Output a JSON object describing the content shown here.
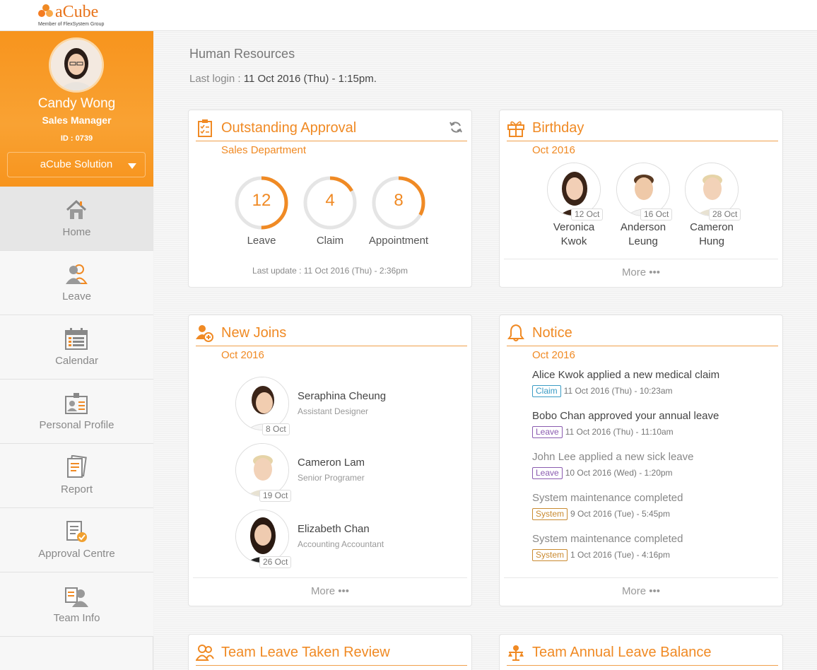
{
  "brand": {
    "logo_text": "aCube",
    "logo_sub": "Member of FlexSystem Group",
    "accent": "#f08a24"
  },
  "profile": {
    "name": "Candy Wong",
    "role": "Sales Manager",
    "id": "ID : 0739",
    "company": "aCube Solution"
  },
  "nav": [
    {
      "label": "Home",
      "icon": "home-icon"
    },
    {
      "label": "Leave",
      "icon": "users-icon"
    },
    {
      "label": "Calendar",
      "icon": "calendar-icon"
    },
    {
      "label": "Personal Profile",
      "icon": "id-badge-icon"
    },
    {
      "label": "Report",
      "icon": "report-icon"
    },
    {
      "label": "Approval Centre",
      "icon": "approval-icon"
    },
    {
      "label": "Team Info",
      "icon": "team-icon"
    }
  ],
  "header": {
    "title": "Human Resources",
    "last_login_label": "Last login :",
    "last_login_value": "11 Oct 2016 (Thu) - 1:15pm."
  },
  "approval": {
    "title": "Outstanding Approval",
    "subtitle": "Sales Department",
    "items": [
      {
        "value": "12",
        "label": "Leave",
        "progress": 0.5
      },
      {
        "value": "4",
        "label": "Claim",
        "progress": 0.17
      },
      {
        "value": "8",
        "label": "Appointment",
        "progress": 0.33
      }
    ],
    "last_update": "Last update : 11 Oct 2016 (Thu) - 2:36pm"
  },
  "birthday": {
    "title": "Birthday",
    "subtitle": "Oct 2016",
    "people": [
      {
        "name1": "Veronica",
        "name2": "Kwok",
        "date": "12 Oct"
      },
      {
        "name1": "Anderson",
        "name2": "Leung",
        "date": "16 Oct"
      },
      {
        "name1": "Cameron",
        "name2": "Hung",
        "date": "28 Oct"
      }
    ],
    "more": "More •••"
  },
  "new_joins": {
    "title": "New Joins",
    "subtitle": "Oct 2016",
    "people": [
      {
        "name": "Seraphina Cheung",
        "role": "Assistant Designer",
        "date": "8 Oct"
      },
      {
        "name": "Cameron Lam",
        "role": "Senior Programer",
        "date": "19 Oct"
      },
      {
        "name": "Elizabeth Chan",
        "role": "Accounting Accountant",
        "date": "26 Oct"
      }
    ],
    "more": "More •••"
  },
  "notice": {
    "title": "Notice",
    "subtitle": "Oct 2016",
    "items": [
      {
        "text": "Alice Kwok applied a new medical claim",
        "tag": "Claim",
        "time": "11 Oct 2016 (Thu) - 10:23am"
      },
      {
        "text": "Bobo Chan approved your annual leave",
        "tag": "Leave",
        "time": "11 Oct 2016 (Thu) - 11:10am"
      },
      {
        "text": "John Lee applied a new sick leave",
        "tag": "Leave",
        "time": "10 Oct 2016 (Wed) - 1:20pm"
      },
      {
        "text": "System maintenance completed",
        "tag": "System",
        "time": "9 Oct 2016 (Tue) - 5:45pm"
      },
      {
        "text": "System maintenance completed",
        "tag": "System",
        "time": "1 Oct 2016 (Tue) - 4:16pm"
      }
    ],
    "more": "More •••"
  },
  "team_leave": {
    "title": "Team Leave Taken Review"
  },
  "team_balance": {
    "title": "Team Annual Leave Balance"
  }
}
